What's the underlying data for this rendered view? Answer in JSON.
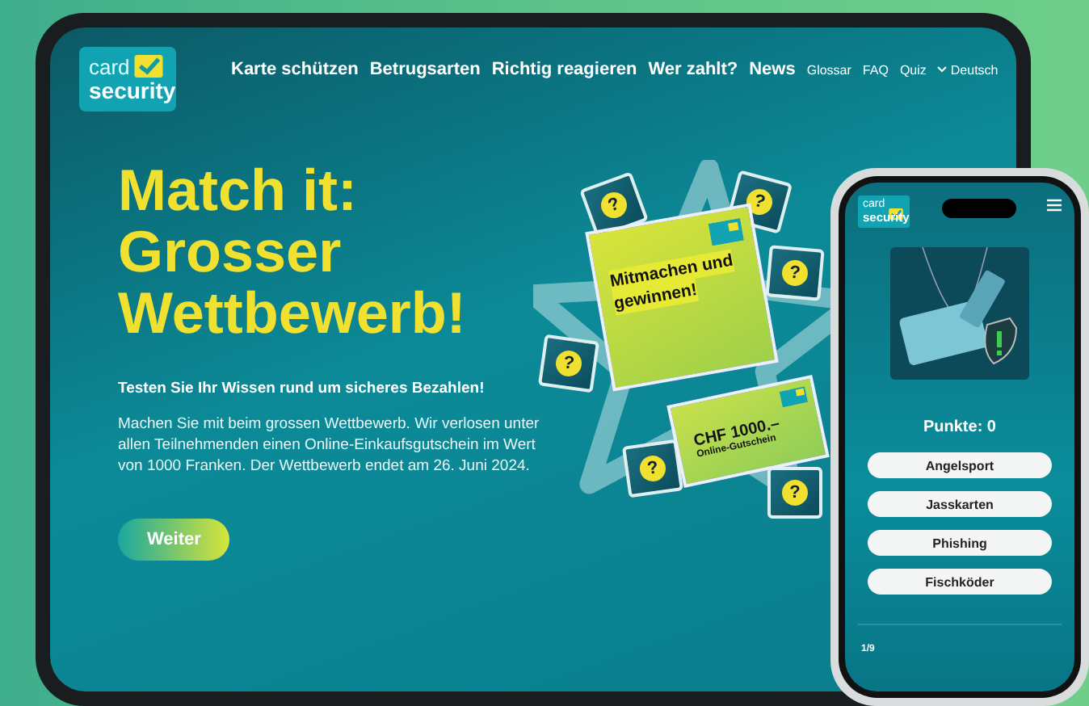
{
  "tablet": {
    "logo": {
      "line1": "card",
      "line2": "security"
    },
    "nav": [
      {
        "label": "Karte schützen",
        "kind": "main"
      },
      {
        "label": "Betrugsarten",
        "kind": "main"
      },
      {
        "label": "Richtig reagieren",
        "kind": "main"
      },
      {
        "label": "Wer zahlt?",
        "kind": "main"
      },
      {
        "label": "News",
        "kind": "main"
      },
      {
        "label": "Glossar",
        "kind": "minor"
      },
      {
        "label": "FAQ",
        "kind": "minor"
      },
      {
        "label": "Quiz",
        "kind": "minor"
      },
      {
        "label": "Deutsch",
        "kind": "language"
      }
    ],
    "hero": {
      "title_lines": [
        "Match it:",
        "Grosser",
        "Wettbewerb!"
      ],
      "subtitle": "Testen Sie Ihr Wissen rund um sicheres Bezahlen!",
      "body": "Machen Sie mit beim grossen Wettbewerb. Wir verlosen unter allen Teilnehmenden einen Online-Einkaufsgutschein im Wert von 1000 Franken. Der Wettbewerb endet am 26. Juni 2024.",
      "button": "Weiter"
    },
    "artwork": {
      "card_lines": [
        "Mitmachen und",
        "gewinnen!"
      ],
      "voucher_amount": "CHF 1000.–",
      "voucher_label": "Online-Gutschein",
      "question_marks": [
        "?",
        "?",
        "?",
        "?",
        "?",
        "?"
      ]
    }
  },
  "phone": {
    "logo": {
      "line1": "card",
      "line2": "security"
    },
    "score": "Punkte: 0",
    "answers": [
      {
        "label": "Angelsport"
      },
      {
        "label": "Jasskarten"
      },
      {
        "label": "Phishing"
      },
      {
        "label": "Fischköder"
      }
    ],
    "progress": "1/9"
  }
}
